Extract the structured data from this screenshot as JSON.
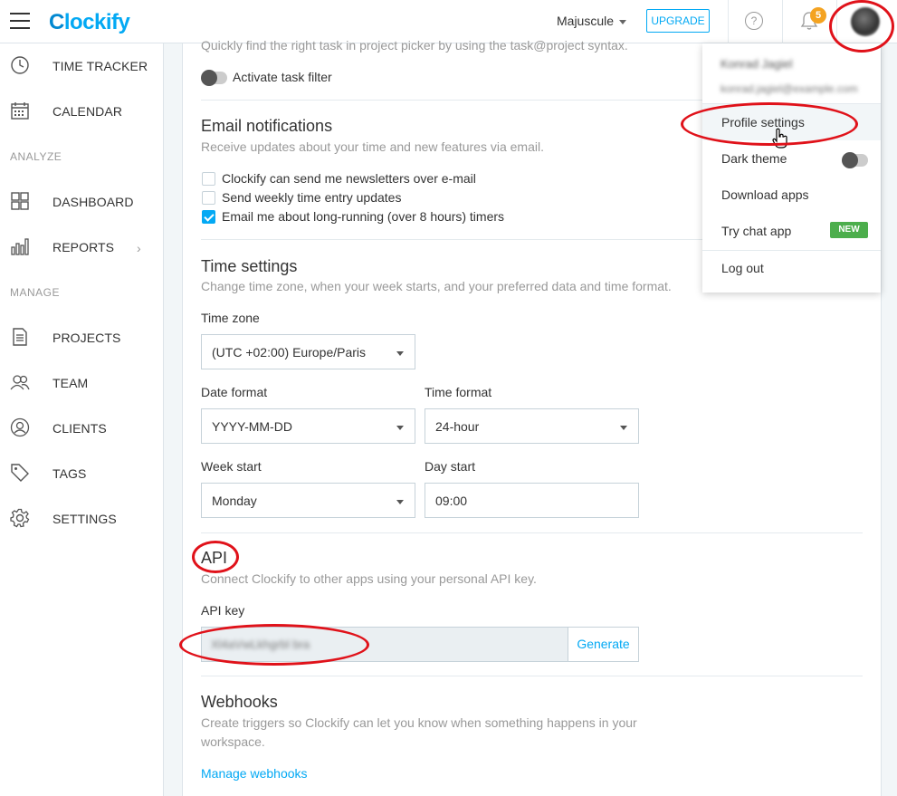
{
  "app": {
    "name": "Clockify",
    "logo_mark": "C",
    "logo_rest": "lockify"
  },
  "topbar": {
    "workspace": "Majuscule",
    "upgrade_label": "UPGRADE",
    "help_glyph": "?",
    "notifications_count": "5"
  },
  "sidebar": {
    "items": [
      {
        "label": "TIME TRACKER",
        "icon": "clock-icon"
      },
      {
        "label": "CALENDAR",
        "icon": "calendar-icon"
      },
      {
        "label": "DASHBOARD",
        "icon": "dashboard-icon"
      },
      {
        "label": "REPORTS",
        "icon": "reports-icon"
      },
      {
        "label": "PROJECTS",
        "icon": "projects-icon"
      },
      {
        "label": "TEAM",
        "icon": "team-icon"
      },
      {
        "label": "CLIENTS",
        "icon": "clients-icon"
      },
      {
        "label": "TAGS",
        "icon": "tag-icon"
      },
      {
        "label": "SETTINGS",
        "icon": "gear-icon"
      }
    ],
    "section_analyze": "ANALYZE",
    "section_manage": "MANAGE"
  },
  "main": {
    "task_filter_hint": "Quickly find the right task in project picker by using the task@project syntax.",
    "task_filter_label": "Activate task filter",
    "email": {
      "title": "Email notifications",
      "subtitle": "Receive updates about your time and new features via email.",
      "options": [
        {
          "label": "Clockify can send me newsletters over e-mail",
          "checked": false
        },
        {
          "label": "Send weekly time entry updates",
          "checked": false
        },
        {
          "label": "Email me about long-running (over 8 hours) timers",
          "checked": true
        }
      ]
    },
    "time": {
      "title": "Time settings",
      "subtitle": "Change time zone, when your week starts, and your preferred data and time format.",
      "timezone_label": "Time zone",
      "timezone_value": "(UTC +02:00) Europe/Paris",
      "date_format_label": "Date format",
      "date_format_value": "YYYY-MM-DD",
      "time_format_label": "Time format",
      "time_format_value": "24-hour",
      "week_start_label": "Week start",
      "week_start_value": "Monday",
      "day_start_label": "Day start",
      "day_start_value": "09:00"
    },
    "api": {
      "title": "API",
      "subtitle": "Connect Clockify to other apps using your personal API key.",
      "key_label": "API key",
      "key_value": "Xl4aVwLkhgrbl bra",
      "generate_label": "Generate"
    },
    "webhooks": {
      "title": "Webhooks",
      "subtitle_line1": "Create triggers so Clockify can let you know when something happens in your",
      "subtitle_line2": "workspace.",
      "manage_label": "Manage webhooks"
    }
  },
  "menu": {
    "user_name": "Konrad Jagiel",
    "user_email": "konrad.jagiel@example.com",
    "items": [
      {
        "label": "Profile settings"
      },
      {
        "label": "Dark theme"
      },
      {
        "label": "Download apps"
      },
      {
        "label": "Try chat app",
        "badge": "NEW"
      },
      {
        "label": "Log out"
      }
    ]
  },
  "colors": {
    "accent": "#03a9f4",
    "annotation": "#e0121a",
    "new_badge": "#4cae4c",
    "notif_badge": "#f4a321"
  }
}
